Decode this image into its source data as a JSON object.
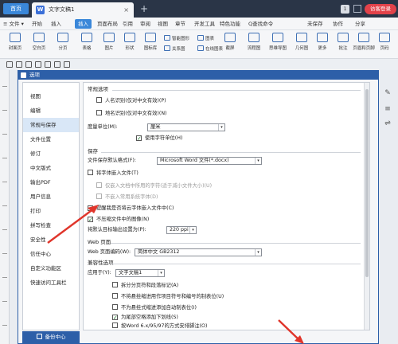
{
  "titlebar": {
    "home_tab": "首页",
    "doc_tab_icon": "W",
    "doc_tab_title": "文字文稿1",
    "close_glyph": "×",
    "new_tab_glyph": "+",
    "badge": "1",
    "login_label": "访客登录"
  },
  "menubar": {
    "items": [
      "≡ 文件 ▾",
      "开始",
      "插入",
      "页面布局",
      "引用",
      "审阅",
      "视图",
      "章节",
      "开发工具",
      "特色功能"
    ],
    "active_index": 2,
    "search": "Q查找命令",
    "right": [
      "未保存",
      "协作",
      "分享"
    ]
  },
  "ribbon": {
    "buttons": [
      "封面页",
      "空白页",
      "分页",
      "表格",
      "图片",
      "形状",
      "图标库",
      "关系图",
      "在线图表",
      "截屏",
      "流程图",
      "思维导图",
      "几何图",
      "更多",
      "批注",
      "页眉和页脚",
      "页码"
    ],
    "small": [
      "智能图形",
      "图表"
    ]
  },
  "dialog": {
    "title": "选项",
    "nav": [
      "视图",
      "编辑",
      "常规与保存",
      "文件位置",
      "修订",
      "中文版式",
      "输出PDF",
      "用户信息",
      "打印",
      "拼写检查",
      "安全性",
      "信任中心",
      "自定义功能区",
      "快速访问工具栏"
    ],
    "nav_selected": 2,
    "backup_label": "备份中心",
    "sections": {
      "general": "常规选项",
      "save": "保存",
      "web": "Web 页面",
      "compat": "兼容性选项"
    },
    "general": {
      "opt1": "人名识别(仅对中文有效)(P)",
      "opt2": "地名识别(仅对中文有效)(N)",
      "unit_label": "度量单位(M):",
      "unit_value": "厘米",
      "char_unit": "使用字符单位(H)"
    },
    "save": {
      "format_label": "文件保存默认格式(F):",
      "format_value": "Microsoft Word 文件(*.docx)",
      "embed_fonts": "将字体嵌入文件(T)",
      "embed_used": "仅嵌入文档中所用的字符(适于减小文件大小)(U)",
      "no_common": "不嵌入常用系统字体(D)",
      "remind_cloud": "提醒我是否将云字体嵌入文件中(C)",
      "no_compress": "不压缩文件中的图像(N)",
      "resolution_label": "将默认目标输出设置为(P):",
      "resolution_value": "220 ppi"
    },
    "web": {
      "encoding_label": "Web 页面编码(W):",
      "encoding_value": "简体中文 GB2312"
    },
    "compat": {
      "apply_label": "应用于(Y):",
      "apply_value": "文字文稿1",
      "items": [
        "拆分分页符和段落标记(A)",
        "不将悬挂缩进用作项目符号和编号的制表位(U)",
        "不为悬挂式缩进添加自动制表位(I)",
        "为尾部空格添加下划线(S)",
        "按Word 6.x/95/97的方式安排脚注(O)"
      ],
      "checked": [
        false,
        false,
        false,
        true,
        false
      ]
    }
  },
  "checks": {
    "opt1": false,
    "opt2": false,
    "char_unit": true,
    "embed_fonts": false,
    "embed_used": false,
    "no_common": false,
    "remind_cloud": true,
    "no_compress": true
  },
  "check_glyph": "✓",
  "dropdown_glyph": "▾",
  "colors": {
    "titlebar": "#2a3547",
    "accent": "#2d5fa8",
    "login": "#e2424a",
    "arrow": "#e0352b"
  }
}
